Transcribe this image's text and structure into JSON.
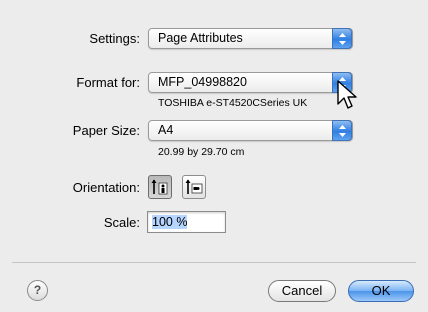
{
  "settings": {
    "label": "Settings:",
    "value": "Page Attributes"
  },
  "format": {
    "label": "Format for:",
    "value": "MFP_04998820",
    "printer": "TOSHIBA e-ST4520CSeries UK"
  },
  "paper": {
    "label": "Paper Size:",
    "value": "A4",
    "dimensions": "20.99 by 29.70 cm"
  },
  "orientation": {
    "label": "Orientation:",
    "selected": "portrait"
  },
  "scale": {
    "label": "Scale:",
    "value": "100 %"
  },
  "help": {
    "symbol": "?"
  },
  "buttons": {
    "cancel": "Cancel",
    "ok": "OK"
  },
  "colors": {
    "accent": "#3d8ee8",
    "background": "#ececec"
  }
}
